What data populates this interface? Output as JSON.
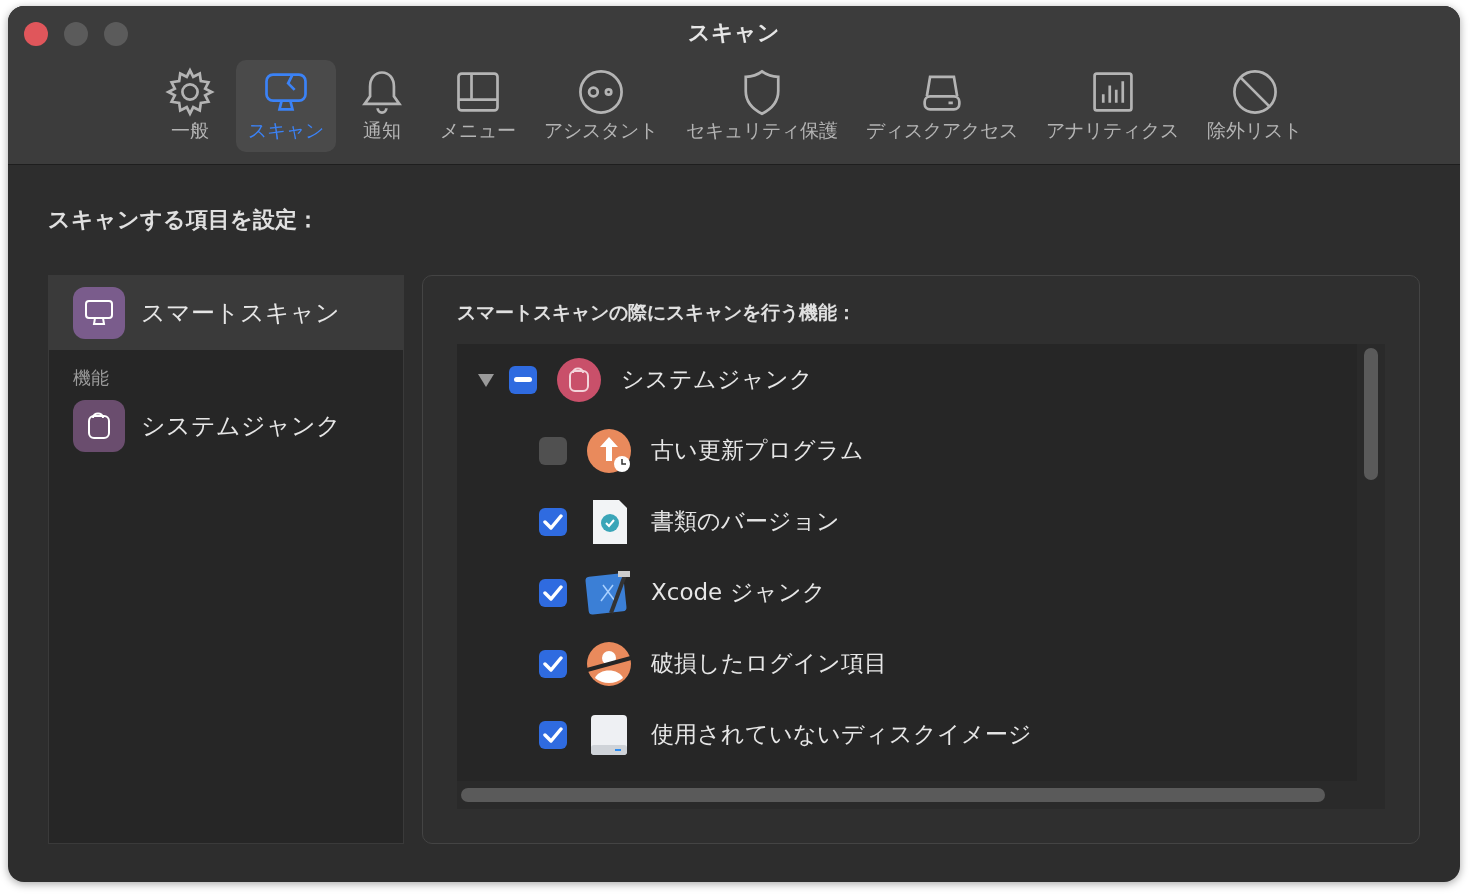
{
  "window": {
    "title": "スキャン"
  },
  "tabs": [
    {
      "label": "一般",
      "selected": false
    },
    {
      "label": "スキャン",
      "selected": true
    },
    {
      "label": "通知",
      "selected": false
    },
    {
      "label": "メニュー",
      "selected": false
    },
    {
      "label": "アシスタント",
      "selected": false
    },
    {
      "label": "セキュリティ保護",
      "selected": false
    },
    {
      "label": "ディスクアクセス",
      "selected": false
    },
    {
      "label": "アナリティクス",
      "selected": false
    },
    {
      "label": "除外リスト",
      "selected": false
    }
  ],
  "heading": "スキャンする項目を設定：",
  "sidebar": {
    "items": [
      {
        "label": "スマートスキャン",
        "selected": true
      }
    ],
    "section": "機能",
    "section_items": [
      {
        "label": "システムジャンク",
        "selected": false
      }
    ]
  },
  "panel": {
    "title": "スマートスキャンの際にスキャンを行う機能：",
    "tree": [
      {
        "label": "システムジャンク",
        "expanded": true,
        "checked": true,
        "mixed": true,
        "children": [
          {
            "label": "古い更新プログラム",
            "checked": false
          },
          {
            "label": "書類のバージョン",
            "checked": true
          },
          {
            "label": "Xcode ジャンク",
            "checked": true
          },
          {
            "label": "破損したログイン項目",
            "checked": true
          },
          {
            "label": "使用されていないディスクイメージ",
            "checked": true
          }
        ]
      }
    ]
  }
}
